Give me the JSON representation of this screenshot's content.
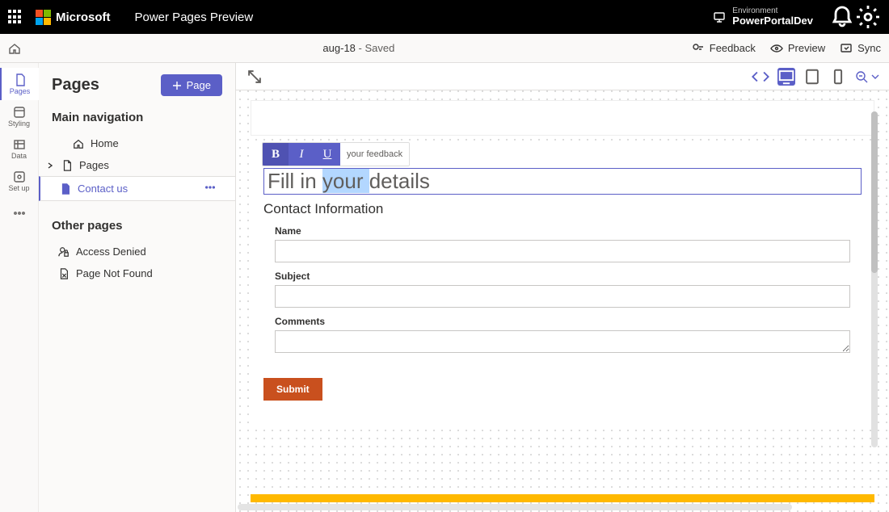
{
  "topbar": {
    "brand": "Microsoft",
    "product": "Power Pages Preview",
    "env_label": "Environment",
    "env_name": "PowerPortalDev"
  },
  "cmdbar": {
    "doc_title": "aug-18",
    "doc_status": " - Saved",
    "feedback": "Feedback",
    "preview": "Preview",
    "sync": "Sync"
  },
  "rail": {
    "pages": "Pages",
    "styling": "Styling",
    "data": "Data",
    "setup": "Set up"
  },
  "sidepanel": {
    "title": "Pages",
    "add_button": "Page",
    "section_main": "Main navigation",
    "section_other": "Other pages",
    "items_main": [
      {
        "label": "Home"
      },
      {
        "label": "Pages"
      },
      {
        "label": "Contact us"
      }
    ],
    "items_other": [
      {
        "label": "Access Denied"
      },
      {
        "label": "Page Not Found"
      }
    ]
  },
  "editor": {
    "toolbar_hint": "your feedback",
    "headline_pre": "Fill in ",
    "headline_sel": "your ",
    "headline_post": "details",
    "section_heading": "Contact Information",
    "fields": {
      "name_label": "Name",
      "subject_label": "Subject",
      "comments_label": "Comments"
    },
    "submit": "Submit",
    "format": {
      "bold": "B",
      "italic": "I",
      "underline": "U"
    }
  }
}
